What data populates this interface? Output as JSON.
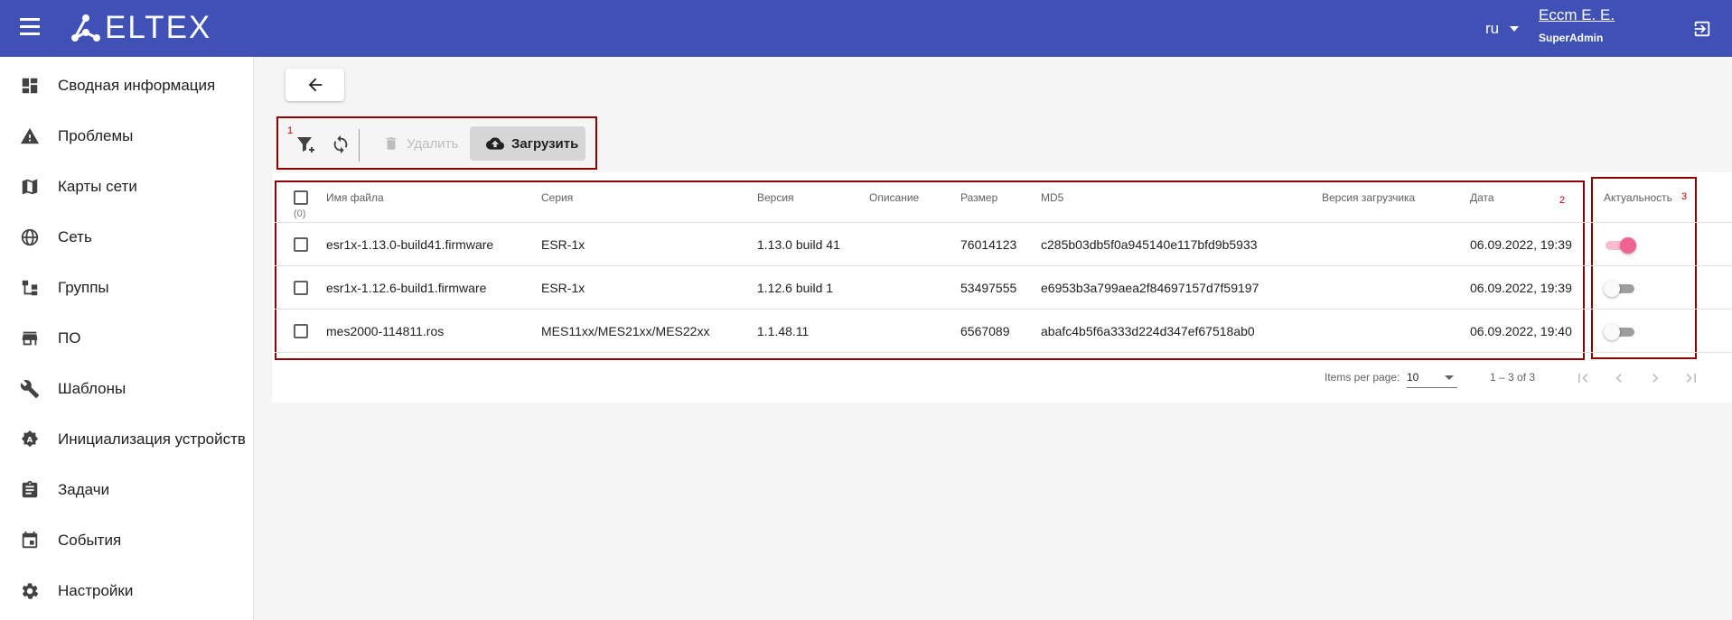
{
  "header": {
    "brand": "ELTEX",
    "language": "ru",
    "user_name": "Eccm E. E.",
    "user_role": "SuperAdmin"
  },
  "sidebar": {
    "items": [
      {
        "label": "Сводная информация",
        "icon": "dashboard-icon"
      },
      {
        "label": "Проблемы",
        "icon": "warning-icon"
      },
      {
        "label": "Карты сети",
        "icon": "map-icon"
      },
      {
        "label": "Сеть",
        "icon": "globe-icon"
      },
      {
        "label": "Группы",
        "icon": "groups-icon"
      },
      {
        "label": "ПО",
        "icon": "store-icon"
      },
      {
        "label": "Шаблоны",
        "icon": "wrench-icon"
      },
      {
        "label": "Инициализация устройств",
        "icon": "init-icon"
      },
      {
        "label": "Задачи",
        "icon": "clipboard-icon"
      },
      {
        "label": "События",
        "icon": "calendar-icon"
      },
      {
        "label": "Настройки",
        "icon": "gear-icon"
      }
    ]
  },
  "toolbar": {
    "annotation": "1",
    "delete_label": "Удалить",
    "upload_label": "Загрузить"
  },
  "table": {
    "annotation": "2",
    "annotation_col": "3",
    "selected_count": "(0)",
    "headers": {
      "filename": "Имя файла",
      "series": "Серия",
      "version": "Версия",
      "description": "Описание",
      "size": "Размер",
      "md5": "MD5",
      "bootloader": "Версия загрузчика",
      "date": "Дата",
      "relevance": "Актуальность"
    },
    "rows": [
      {
        "filename": "esr1x-1.13.0-build41.firmware",
        "series": "ESR-1x",
        "version": "1.13.0 build 41",
        "description": "",
        "size": "76014123",
        "md5": "c285b03db5f0a945140e117bfd9b5933",
        "bootloader": "",
        "date": "06.09.2022, 19:39",
        "relevant": true
      },
      {
        "filename": "esr1x-1.12.6-build1.firmware",
        "series": "ESR-1x",
        "version": "1.12.6 build 1",
        "description": "",
        "size": "53497555",
        "md5": "e6953b3a799aea2f84697157d7f59197",
        "bootloader": "",
        "date": "06.09.2022, 19:39",
        "relevant": false
      },
      {
        "filename": "mes2000-114811.ros",
        "series": "MES11xx/MES21xx/MES22xx",
        "version": "1.1.48.11",
        "description": "",
        "size": "6567089",
        "md5": "abafc4b5f6a333d224d347ef67518ab0",
        "bootloader": "",
        "date": "06.09.2022, 19:40",
        "relevant": false
      }
    ]
  },
  "pagination": {
    "items_per_page_label": "Items per page:",
    "items_per_page_value": "10",
    "range": "1 – 3 of 3"
  },
  "colors": {
    "header_bg": "#3f51b5",
    "annotation_border": "#8b0000",
    "toggle_on": "#f06292"
  }
}
